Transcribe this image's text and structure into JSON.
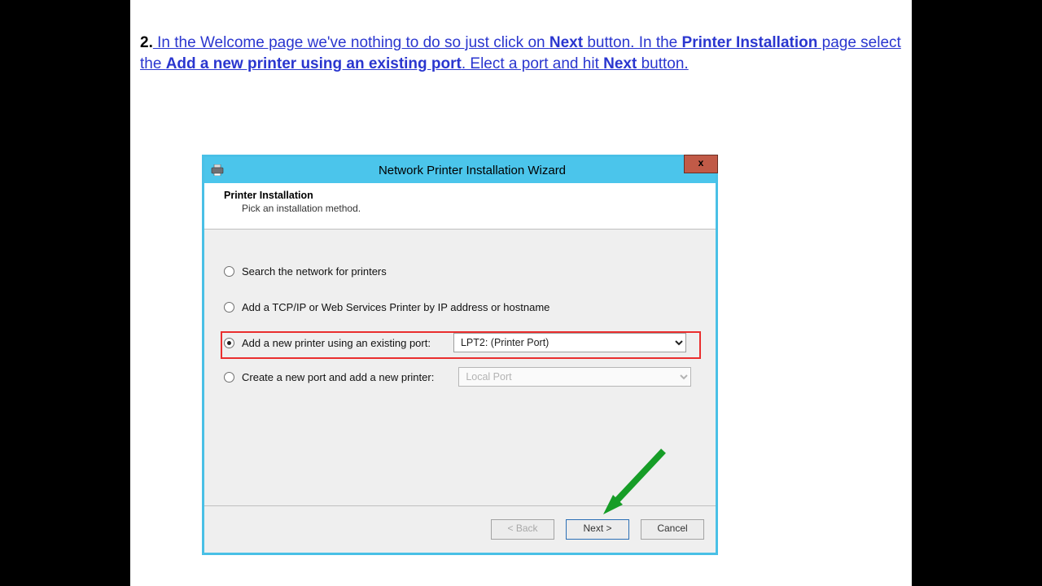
{
  "instruction": {
    "number": "2.",
    "seg1": " In the Welcome page we've nothing to do so just click on ",
    "seg1b": "Next",
    "seg1c": " button. In the ",
    "seg2": "Printer Installation",
    "seg3": " page select the ",
    "seg4": "Add a new printer using an existing port",
    "seg5": ". Elect a port and hit ",
    "seg5b": "Next",
    "seg5c": " button."
  },
  "dialog": {
    "title": "Network Printer Installation Wizard",
    "close": "x",
    "header_title": "Printer Installation",
    "header_sub": "Pick an installation method.",
    "options": {
      "o1": "Search the network for printers",
      "o2": "Add a TCP/IP or Web Services Printer by IP address or hostname",
      "o3": "Add a new printer using an existing port:",
      "o4": "Create a new port and add a new printer:"
    },
    "port_selected": "LPT2: (Printer Port)",
    "porttype_selected": "Local Port",
    "buttons": {
      "back": "< Back",
      "next": "Next >",
      "cancel": "Cancel"
    }
  }
}
